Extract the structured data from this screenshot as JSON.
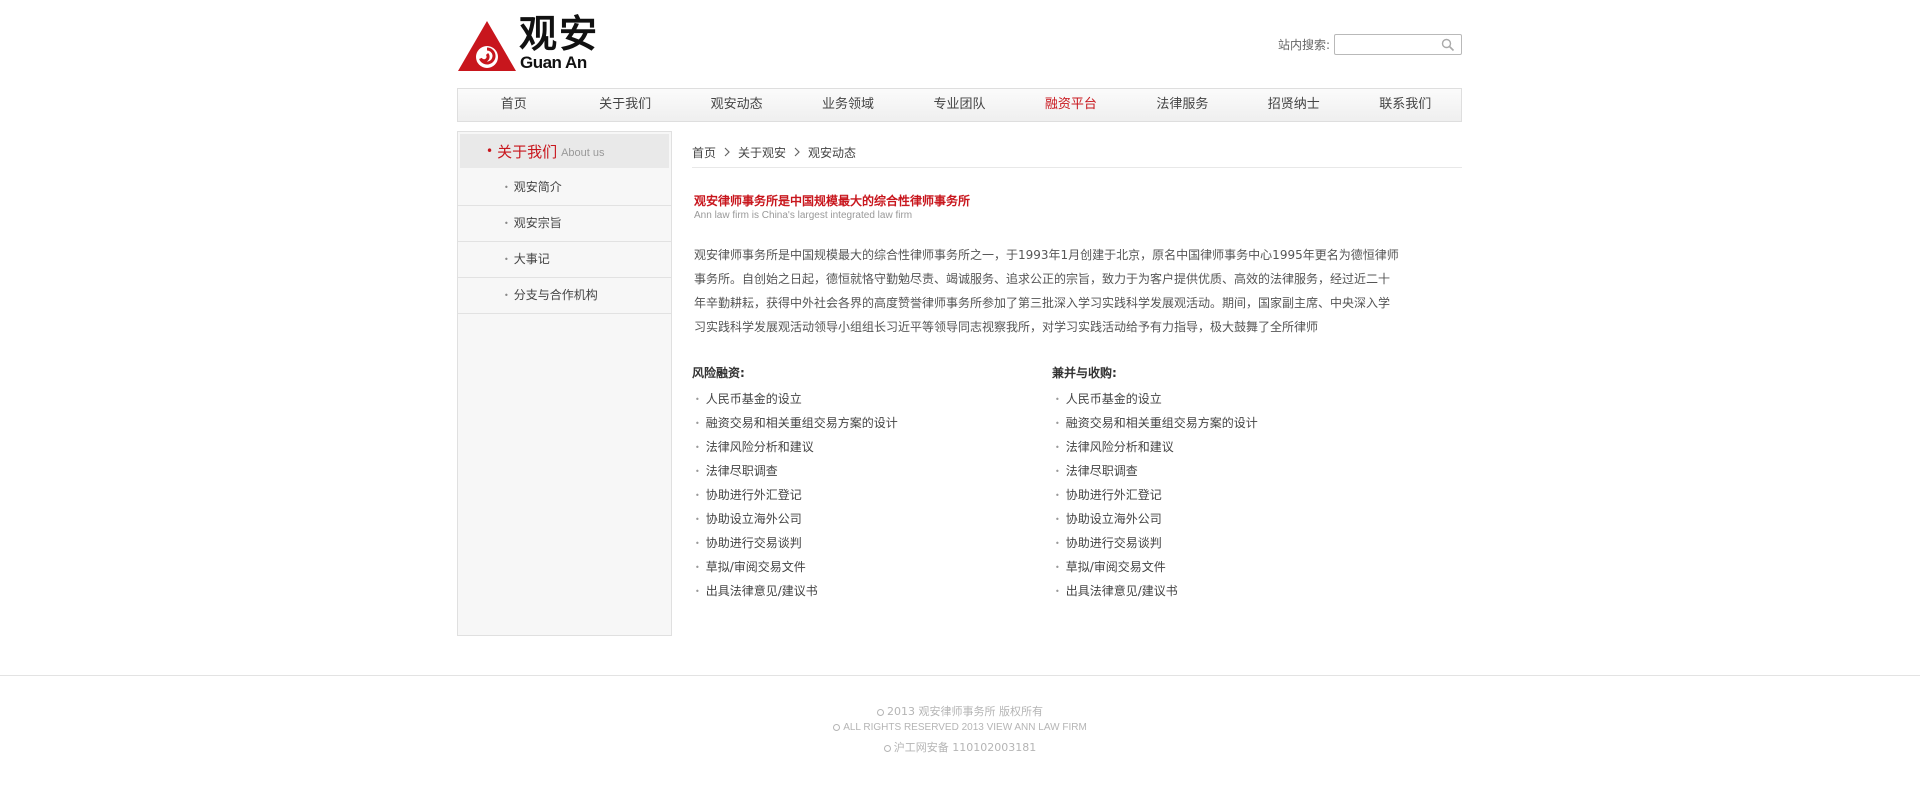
{
  "brand": {
    "name_cn": "观安",
    "name_en": "Guan An",
    "accent_color": "#c8161d"
  },
  "search": {
    "label": "站内搜索:",
    "value": "",
    "placeholder": ""
  },
  "nav": {
    "items": [
      "首页",
      "关于我们",
      "观安动态",
      "业务领域",
      "专业团队",
      "融资平台",
      "法律服务",
      "招贤纳士",
      "联系我们"
    ],
    "active_index": 5
  },
  "sidebar": {
    "title": "关于我们",
    "subtitle": "About us",
    "items": [
      "观安简介",
      "观安宗旨",
      "大事记",
      "分支与合作机构"
    ]
  },
  "breadcrumb": [
    "首页",
    "关于观安",
    "观安动态"
  ],
  "article": {
    "title_cn": "观安律师事务所是中国规模最大的综合性律师事务所",
    "title_en": "Ann law firm is China's largest integrated law firm",
    "intro": "观安律师事务所是中国规模最大的综合性律师事务所之一，于1993年1月创建于北京，原名中国律师事务中心1995年更名为德恒律师事务所。自创始之日起，德恒就恪守勤勉尽责、竭诚服务、追求公正的宗旨，致力于为客户提供优质、高效的法律服务，经过近二十年辛勤耕耘，获得中外社会各界的高度赞誉律师事务所参加了第三批深入学习实践科学发展观活动。期间，国家副主席、中央深入学习实践科学发展观活动领导小组组长习近平等领导同志视察我所，对学习实践活动给予有力指导，极大鼓舞了全所律师"
  },
  "columns": [
    {
      "title": "风险融资:",
      "items": [
        "人民币基金的设立",
        "融资交易和相关重组交易方案的设计",
        "法律风险分析和建议",
        "法律尽职调查",
        "协助进行外汇登记",
        "协助设立海外公司",
        "协助进行交易谈判",
        "草拟/审阅交易文件",
        "出具法律意见/建议书"
      ]
    },
    {
      "title": "兼并与收购:",
      "items": [
        "人民币基金的设立",
        "融资交易和相关重组交易方案的设计",
        "法律风险分析和建议",
        "法律尽职调查",
        "协助进行外汇登记",
        "协助设立海外公司",
        "协助进行交易谈判",
        "草拟/审阅交易文件",
        "出具法律意见/建议书"
      ]
    }
  ],
  "footer": {
    "line1": "2013  观安律师事务所  版权所有",
    "line2": "ALL RIGHTS RESERVED 2013 VIEW ANN LAW FIRM",
    "line3": "沪工网安备  110102003181"
  }
}
